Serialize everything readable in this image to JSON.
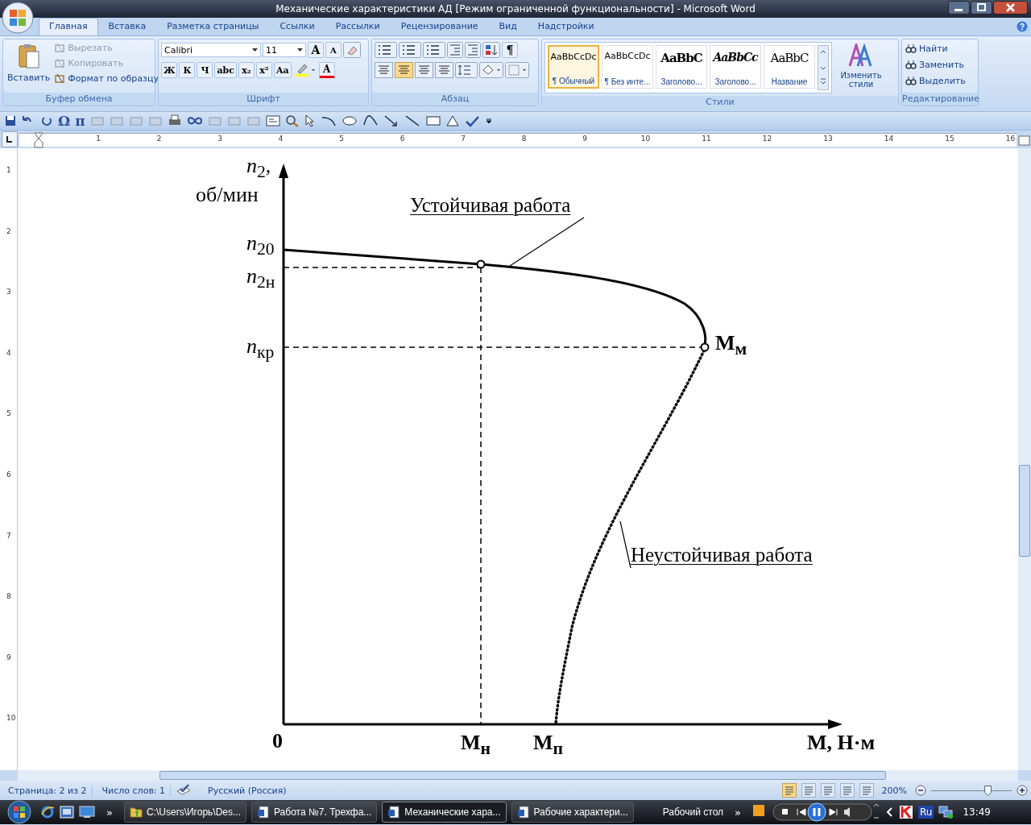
{
  "window": {
    "title": "Механические характеристики АД [Режим ограниченной функциональности] - Microsoft Word"
  },
  "tabs": [
    {
      "label": "Главная",
      "selected": true
    },
    {
      "label": "Вставка",
      "selected": false
    },
    {
      "label": "Разметка страницы",
      "selected": false
    },
    {
      "label": "Ссылки",
      "selected": false
    },
    {
      "label": "Рассылки",
      "selected": false
    },
    {
      "label": "Рецензирование",
      "selected": false
    },
    {
      "label": "Вид",
      "selected": false
    },
    {
      "label": "Надстройки",
      "selected": false
    }
  ],
  "clipboard": {
    "paste": "Вставить",
    "items": [
      {
        "label": "Вырезать",
        "disabled": true
      },
      {
        "label": "Копировать",
        "disabled": true
      },
      {
        "label": "Формат по образцу",
        "disabled": false
      }
    ],
    "group": "Буфер обмена"
  },
  "font": {
    "name": "Calibri",
    "size": "11",
    "grow": "A",
    "shrink": "A",
    "format_buttons": [
      "Ж",
      "К",
      "Ч",
      "abc",
      "x₂",
      "x²",
      "Aa"
    ],
    "color_letter": "A",
    "group": "Шрифт"
  },
  "paragraph": {
    "alignment": [
      {
        "selected": false
      },
      {
        "selected": true
      },
      {
        "selected": false
      },
      {
        "selected": false
      }
    ],
    "pilcrow": "¶",
    "group": "Абзац"
  },
  "styles": {
    "items": [
      {
        "sample": "AaBbCcDc",
        "name": "¶ Обычный",
        "selected": true,
        "kind": "normal"
      },
      {
        "sample": "AaBbCcDc",
        "name": "¶ Без инте...",
        "selected": false,
        "kind": "normal"
      },
      {
        "sample": "AaBbC",
        "name": "Заголово...",
        "selected": false,
        "kind": "heading"
      },
      {
        "sample": "AaBbCc",
        "name": "Заголово...",
        "selected": false,
        "kind": "heading-italic"
      },
      {
        "sample": "AaBbC",
        "name": "Название",
        "selected": false,
        "kind": "title"
      }
    ],
    "change": "Изменить стили",
    "group": "Стили"
  },
  "editing": {
    "items": [
      "Найти",
      "Заменить",
      "Выделить"
    ],
    "group": "Редактирование"
  },
  "quick_access": {
    "symbols": [
      "Ω",
      "π"
    ]
  },
  "ruler": {
    "horizontal": [
      "1",
      "2",
      "3",
      "4",
      "5",
      "6",
      "7",
      "8",
      "9",
      "10",
      "11",
      "12",
      "13",
      "14",
      "15",
      "16"
    ],
    "vertical": [
      "1",
      "2",
      "3",
      "4",
      "5",
      "6",
      "7",
      "8",
      "9",
      "10"
    ]
  },
  "diagram": {
    "y_symbol": "*n*$_{2}$,",
    "y_unit": "об/мин",
    "stable": "Устойчивая работа",
    "n20": "*n*$_{20}$",
    "n2n": "*n*$_{2н}$",
    "nkr": "*n*$_{кр}$",
    "mm": "М$_{м}$",
    "unstable": "Неустойчивая работа",
    "origin": "0",
    "mn": "М$_{н}$",
    "mp": "М$_{п}$",
    "x_label": "М, Н·м"
  },
  "status_bar": {
    "page": "Страница: 2 из 2",
    "words": "Число слов: 1",
    "language": "Русский (Россия)",
    "zoom": "200%",
    "zoom_slider": {
      "level": 0.72
    },
    "views": [
      {
        "selected": true
      },
      {
        "selected": false
      },
      {
        "selected": false
      },
      {
        "selected": false
      },
      {
        "selected": false
      }
    ]
  },
  "taskbar": {
    "more": "»",
    "items": [
      {
        "label": "C:\\Users\\Игорь\\Des...",
        "selected": false,
        "kind": "folder"
      },
      {
        "label": "Работа №7. Трехфа...",
        "selected": false,
        "kind": "word"
      },
      {
        "label": "Механические хара...",
        "selected": true,
        "kind": "word"
      },
      {
        "label": "Рабочие характери...",
        "selected": false,
        "kind": "word"
      }
    ],
    "desktop": "Рабочий стол",
    "tray_more": "»",
    "language": "Ru",
    "time": "13:49"
  }
}
